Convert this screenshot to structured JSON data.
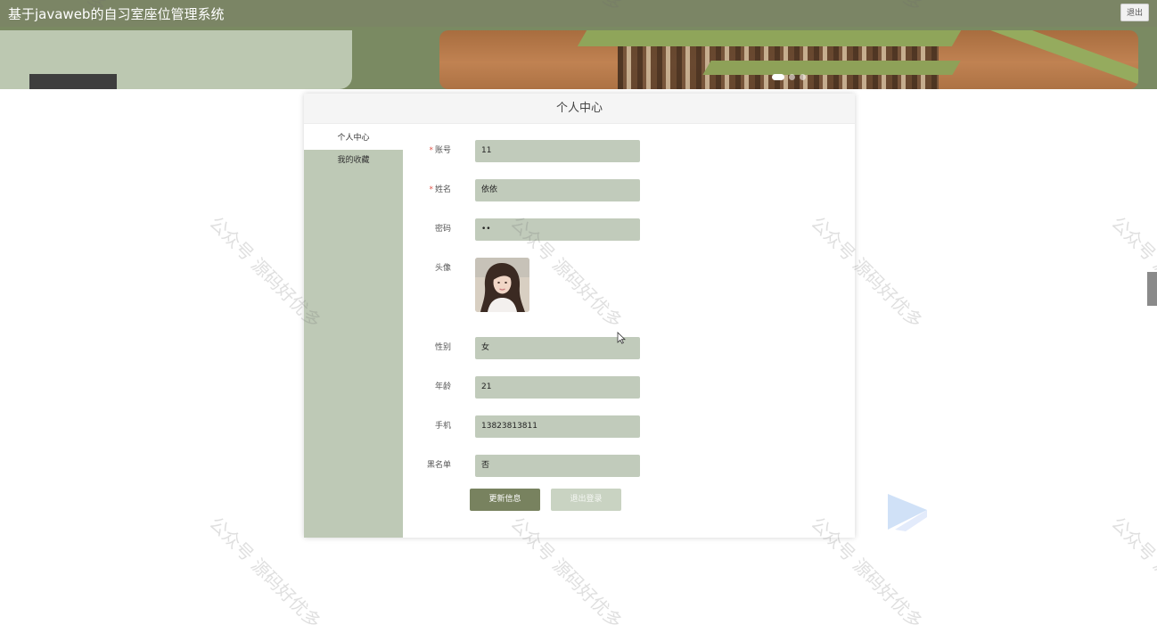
{
  "header": {
    "title": "基于javaweb的自习室座位管理系统",
    "logout_label": "退出"
  },
  "banner": {
    "slide_count": 3,
    "active_slide": 1
  },
  "card": {
    "title": "个人中心"
  },
  "sidebar": {
    "items": [
      {
        "label": "个人中心",
        "active": true
      },
      {
        "label": "我的收藏",
        "active": false
      }
    ]
  },
  "form": {
    "account": {
      "label": "账号",
      "value": "11",
      "required": true
    },
    "name": {
      "label": "姓名",
      "value": "依依",
      "required": true
    },
    "password": {
      "label": "密码",
      "value": "••",
      "required": false
    },
    "avatar": {
      "label": "头像"
    },
    "gender": {
      "label": "性别",
      "value": "女"
    },
    "age": {
      "label": "年龄",
      "value": "21"
    },
    "phone": {
      "label": "手机",
      "value": "13823813811"
    },
    "blacklist": {
      "label": "黑名单",
      "value": "否"
    }
  },
  "buttons": {
    "update_label": "更新信息",
    "logout_label": "退出登录"
  },
  "watermark": {
    "text": "公众号 源码好优多"
  },
  "colors": {
    "header_bg": "#7b8565",
    "sidebar_bg": "#bec9b6",
    "field_bg": "#c1cbbb",
    "primary_button": "#78825f",
    "required_mark": "#e0554a"
  }
}
